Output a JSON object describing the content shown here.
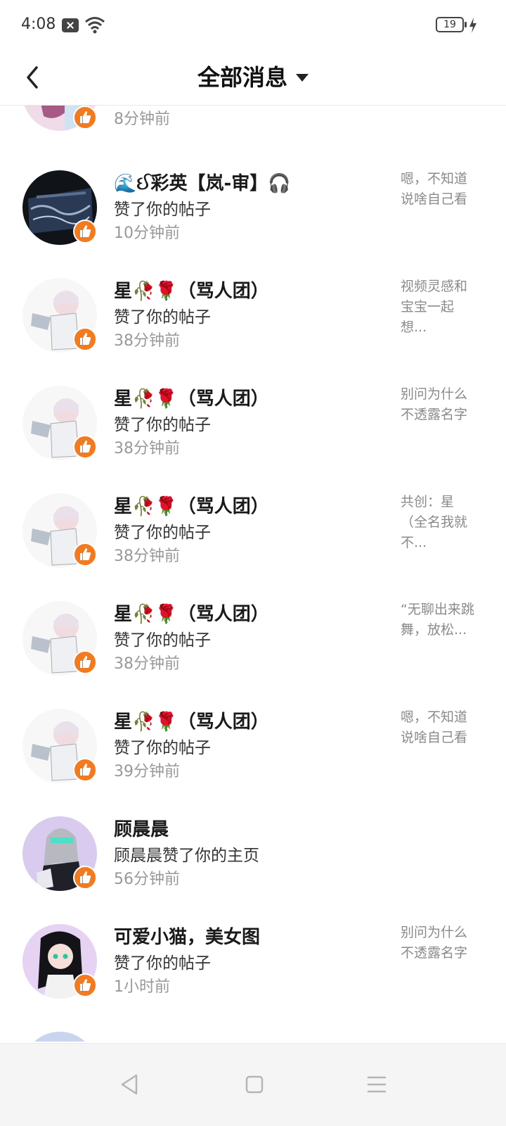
{
  "status": {
    "time": "4:08",
    "battery": "19"
  },
  "header": {
    "title": "全部消息"
  },
  "messages": [
    {
      "time": "8分钟前"
    },
    {
      "name": "🌊ઈ彩英【岚-审】🎧",
      "action": "赞了你的帖子",
      "time": "10分钟前",
      "preview": [
        "嗯，不知道",
        "说啥自己看"
      ]
    },
    {
      "name": "星🥀🌹（骂人团）",
      "action": "赞了你的帖子",
      "time": "38分钟前",
      "preview": [
        "视频灵感和",
        "宝宝一起",
        "想..."
      ]
    },
    {
      "name": "星🥀🌹（骂人团）",
      "action": "赞了你的帖子",
      "time": "38分钟前",
      "preview": [
        "别问为什么",
        "不透露名字"
      ]
    },
    {
      "name": "星🥀🌹（骂人团）",
      "action": "赞了你的帖子",
      "time": "38分钟前",
      "preview": [
        "共创：星",
        "（全名我就",
        "不..."
      ]
    },
    {
      "name": "星🥀🌹（骂人团）",
      "action": "赞了你的帖子",
      "time": "38分钟前",
      "preview": [
        "“无聊出来跳",
        "舞，放松..."
      ]
    },
    {
      "name": "星🥀🌹（骂人团）",
      "action": "赞了你的帖子",
      "time": "39分钟前",
      "preview": [
        "嗯，不知道",
        "说啥自己看"
      ]
    },
    {
      "name": "顾晨晨",
      "action": "顾晨晨赞了你的主页",
      "time": "56分钟前"
    },
    {
      "name": "可爱小猫，美女图",
      "action": "赞了你的帖子",
      "time": "1小时前",
      "preview": [
        "别问为什么",
        "不透露名字"
      ]
    }
  ],
  "colors": {
    "like_badge": "#f47a20",
    "accent_text": "#1a1a1a",
    "muted_text": "#999999"
  }
}
